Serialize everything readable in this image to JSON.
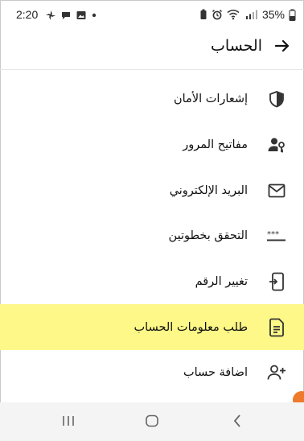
{
  "status_bar": {
    "time": "2:20",
    "battery_percent": "35%",
    "left_icons": [
      "pinwheel-icon",
      "chat-icon",
      "image-icon",
      "dot-icon"
    ],
    "right_icons": [
      "battery-saver-icon",
      "alarm-icon",
      "wifi-icon",
      "lte-signal-icon",
      "battery-icon"
    ]
  },
  "header": {
    "title": "الحساب",
    "back_icon": "arrow-right-icon"
  },
  "menu": {
    "items": [
      {
        "label": "إشعارات الأمان",
        "icon": "shield-icon",
        "highlighted": false
      },
      {
        "label": "مفاتيح المرور",
        "icon": "person-key-icon",
        "highlighted": false
      },
      {
        "label": "البريد الإلكتروني",
        "icon": "mail-icon",
        "highlighted": false
      },
      {
        "label": "التحقق بخطوتين",
        "icon": "password-dots-icon",
        "highlighted": false
      },
      {
        "label": "تغيير الرقم",
        "icon": "phone-transfer-icon",
        "highlighted": false
      },
      {
        "label": "طلب معلومات الحساب",
        "icon": "document-icon",
        "highlighted": true
      },
      {
        "label": "اضافة حساب",
        "icon": "add-person-icon",
        "highlighted": false
      }
    ]
  },
  "colors": {
    "highlight": "#fdf887",
    "nav_background": "#f4f4f4",
    "badge": "#ef7a2b"
  },
  "nav_bar": {
    "icons": [
      "recents-icon",
      "home-icon",
      "back-nav-icon"
    ]
  }
}
